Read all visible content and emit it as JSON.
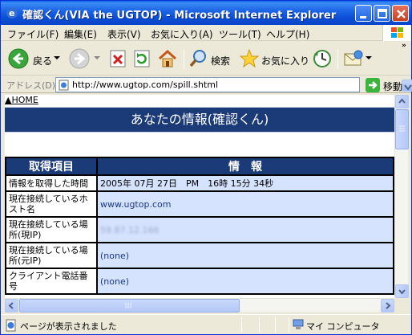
{
  "window": {
    "title": "確認くん(VIA the UGTOP) - Microsoft Internet Explorer"
  },
  "menu": {
    "items": [
      "ファイル(F)",
      "編集(E)",
      "表示(V)",
      "お気に入り(A)",
      "ツール(T)",
      "ヘルプ(H)"
    ]
  },
  "toolbar": {
    "back_label": "戻る",
    "search_label": "検索",
    "favorites_label": "お気に入り",
    "overflow": "»"
  },
  "address": {
    "label": "アドレス(D)",
    "url": "http://www.ugtop.com/spill.shtml",
    "go_label": "移動"
  },
  "page": {
    "home_link": "▲HOME",
    "banner_title": "あなたの情報(確認くん)",
    "table": {
      "headers": [
        "取得項目",
        "情　報"
      ],
      "rows": [
        {
          "key": "情報を取得した時間",
          "value": "2005年 07月 27日　PM　16時 15分 34秒"
        },
        {
          "key": "現在接続しているホスト名",
          "value": "www.ugtop.com"
        },
        {
          "key": "現在接続している場所(現IP)",
          "value": "59.87.12.166"
        },
        {
          "key": "現在接続している場所(元IP)",
          "value": "(none)"
        },
        {
          "key": "クライアント電話番号",
          "value": "(none)"
        }
      ]
    }
  },
  "status": {
    "text": "ページが表示されました",
    "zone": "マイ コンピュータ"
  }
}
